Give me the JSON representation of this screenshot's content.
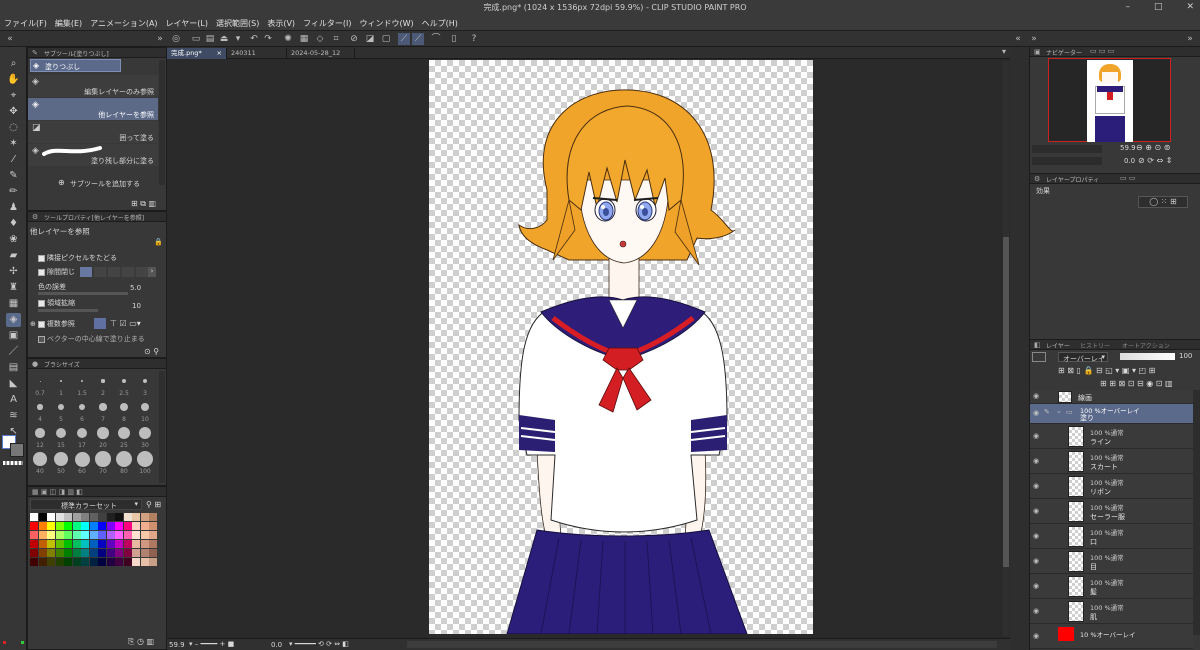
{
  "window": {
    "title": "完成.png* (1024 x 1536px 72dpi 59.9%)  - CLIP STUDIO PAINT PRO",
    "menu": [
      "ファイル(F)",
      "編集(E)",
      "アニメーション(A)",
      "レイヤー(L)",
      "選択範囲(S)",
      "表示(V)",
      "フィルター(I)",
      "ウィンドウ(W)",
      "ヘルプ(H)"
    ],
    "controls": [
      "–",
      "□",
      "✕"
    ]
  },
  "subtool": {
    "header": "サブツール[塗りつぶし]",
    "group_label": "塗りつぶし",
    "items": [
      {
        "label": "編集レイヤーのみ参照"
      },
      {
        "label": "他レイヤーを参照"
      },
      {
        "label": "囲って塗る"
      },
      {
        "label": "塗り残し部分に塗る"
      }
    ],
    "add_label": "サブツールを追加する"
  },
  "tool_property": {
    "header": "ツールプロパティ[他レイヤーを参照]",
    "title": "他レイヤーを参照",
    "rows": [
      {
        "label": "隣接ピクセルをたどる"
      },
      {
        "label": "隙間閉じ"
      },
      {
        "label": "色の誤差",
        "value": "5.0"
      },
      {
        "label": "領域拡縮",
        "value": "10"
      },
      {
        "label": "複数参照"
      },
      {
        "label": "ベクターの中心線で塗り止まる"
      }
    ]
  },
  "brush_size": {
    "header": "ブラシサイズ",
    "sizes": [
      "0.7",
      "1",
      "1.5",
      "2",
      "2.5",
      "3",
      "4",
      "5",
      "6",
      "7",
      "8",
      "10",
      "12",
      "15",
      "17",
      "20",
      "25",
      "30",
      "40",
      "50",
      "60",
      "70",
      "80",
      "100"
    ]
  },
  "color_set": {
    "header": "標準カラーセット",
    "colors": {
      "row1": [
        "#ffffff",
        "#000000",
        "#ffffff",
        "#e0e0e0",
        "#c0c0c0",
        "#a0a0a0",
        "#808080",
        "#606060",
        "#404040",
        "#202020",
        "#101010",
        "#f0e0d0",
        "#e8c8a8",
        "#d0a080",
        "#b08060"
      ],
      "row2": [
        "#ff0000",
        "#ff8000",
        "#ffff00",
        "#80ff00",
        "#00ff00",
        "#00ff80",
        "#00ffff",
        "#0080ff",
        "#0000ff",
        "#8000ff",
        "#ff00ff",
        "#ff0080",
        "#ffd0c0",
        "#f0b090",
        "#d09070"
      ],
      "row3": [
        "#ff6060",
        "#ffb060",
        "#ffff80",
        "#b0ff60",
        "#60ff60",
        "#60ffb0",
        "#60ffff",
        "#60b0ff",
        "#6060ff",
        "#b060ff",
        "#ff60ff",
        "#ff60b0",
        "#ffe0d0",
        "#f8c8a8",
        "#e0a888"
      ],
      "row4": [
        "#c00000",
        "#c06000",
        "#c0c000",
        "#60c000",
        "#00c000",
        "#00c060",
        "#00c0c0",
        "#0060c0",
        "#0000c0",
        "#6000c0",
        "#c000c0",
        "#c00060",
        "#e8b8a0",
        "#d09880",
        "#b07860"
      ],
      "row5": [
        "#800000",
        "#804000",
        "#808000",
        "#408000",
        "#008000",
        "#008040",
        "#008080",
        "#004080",
        "#000080",
        "#400080",
        "#800080",
        "#800040",
        "#d0a090",
        "#b08070",
        "#906050"
      ],
      "row6": [
        "#400000",
        "#402000",
        "#404000",
        "#204000",
        "#004000",
        "#004020",
        "#004040",
        "#002040",
        "#000040",
        "#200040",
        "#400040",
        "#400020",
        "#f8d8c8",
        "#e8c0a8",
        "#c8a088"
      ]
    }
  },
  "canvas": {
    "tabs": [
      "完成.png*",
      "240311",
      "2024-05-28_12"
    ],
    "zoom": "59.9",
    "rotation": "0.0"
  },
  "navigator": {
    "header": "ナビゲーター",
    "zoom": "59.9",
    "rotation": "0.0"
  },
  "layer_property": {
    "header": "レイヤープロパティ",
    "effect_label": "効果"
  },
  "layers": {
    "header": "レイヤー",
    "other_tabs": [
      "ヒストリー",
      "オートアクション"
    ],
    "blend_mode": "オーバーレイ",
    "opacity": "100",
    "items": [
      {
        "mode": "",
        "name": "線画",
        "type": "plain"
      },
      {
        "mode": "100 %オーバーレイ",
        "name": "塗り",
        "type": "folder"
      },
      {
        "mode": "100 %通常",
        "name": "ライン",
        "type": "layer"
      },
      {
        "mode": "100 %通常",
        "name": "スカート",
        "type": "layer"
      },
      {
        "mode": "100 %通常",
        "name": "リボン",
        "type": "layer"
      },
      {
        "mode": "100 %通常",
        "name": "セーラー服",
        "type": "layer"
      },
      {
        "mode": "100 %通常",
        "name": "口",
        "type": "layer"
      },
      {
        "mode": "100 %通常",
        "name": "目",
        "type": "layer"
      },
      {
        "mode": "100 %通常",
        "name": "髪",
        "type": "layer"
      },
      {
        "mode": "100 %通常",
        "name": "肌",
        "type": "layer"
      },
      {
        "mode": "",
        "name": "10 %オーバーレイ",
        "type": "red"
      }
    ]
  }
}
